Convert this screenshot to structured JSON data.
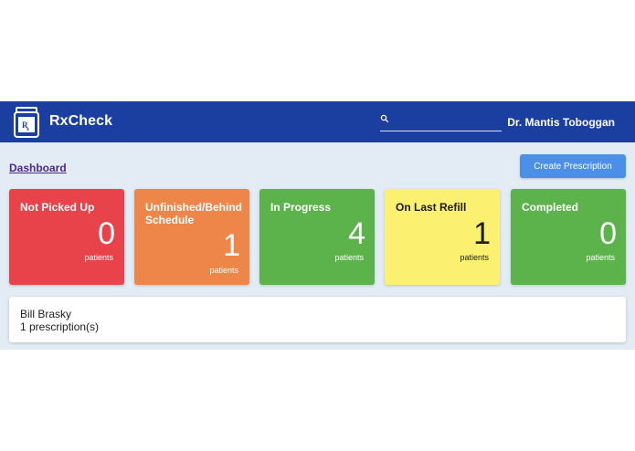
{
  "navbar": {
    "brand": "RxCheck",
    "logo_icon": "pill-bottle-icon",
    "search": {
      "placeholder": "",
      "value": "",
      "icon": "search-icon"
    },
    "user": "Dr. Mantis Toboggan",
    "color": "#1b3fa0"
  },
  "toolbar": {
    "dashboard_link": "Dashboard",
    "create_button": "Create Prescription"
  },
  "status_cards": [
    {
      "title": "Not Picked Up",
      "count": "0",
      "unit": "patients",
      "color": "#e8434a"
    },
    {
      "title": "Unfinished/Behind Schedule",
      "count": "1",
      "unit": "patients",
      "color": "#ee8549"
    },
    {
      "title": "In Progress",
      "count": "4",
      "unit": "patients",
      "color": "#5cb34b"
    },
    {
      "title": "On Last Refill",
      "count": "1",
      "unit": "patients",
      "color": "#fbf06f"
    },
    {
      "title": "Completed",
      "count": "0",
      "unit": "patients",
      "color": "#5cb34b"
    }
  ],
  "patients": [
    {
      "name": "Bill Brasky",
      "prescriptions": "1 prescription(s)"
    }
  ]
}
